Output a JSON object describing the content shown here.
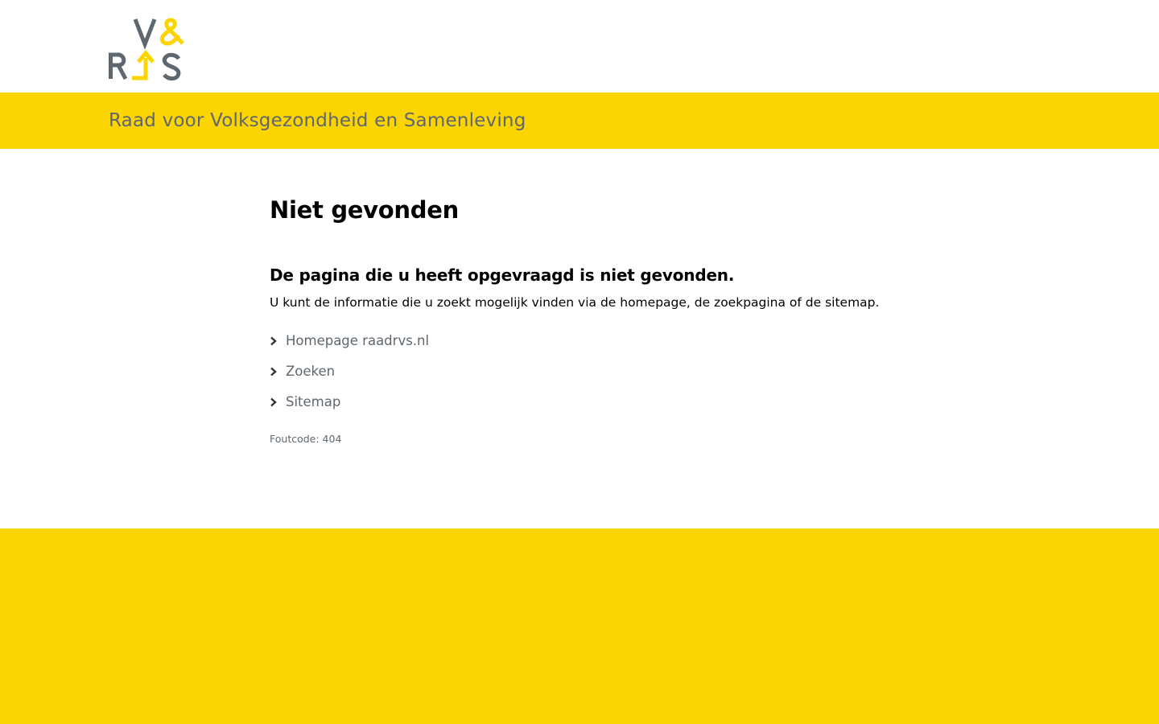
{
  "header": {
    "logo": {
      "text_top": "V&",
      "text_bottom": "RVS",
      "colors": {
        "grey": "#5e6770",
        "yellow": "#fcd500"
      }
    },
    "org_name": "Raad voor Volksgezondheid en Samenleving"
  },
  "main": {
    "title": "Niet gevonden",
    "subheading": "De pagina die u heeft opgevraagd is niet gevonden.",
    "intro": "U kunt de informatie die u zoekt mogelijk vinden via de homepage, de zoekpagina of de sitemap.",
    "links": [
      {
        "label": "Homepage raadrvs.nl",
        "icon": "chevron-right-icon"
      },
      {
        "label": "Zoeken",
        "icon": "chevron-right-icon"
      },
      {
        "label": "Sitemap",
        "icon": "chevron-right-icon"
      }
    ],
    "error_code": "Foutcode: 404"
  },
  "colors": {
    "accent": "#fcd500",
    "text_grey": "#5e6770",
    "text_dark": "#000000",
    "background": "#ffffff"
  }
}
